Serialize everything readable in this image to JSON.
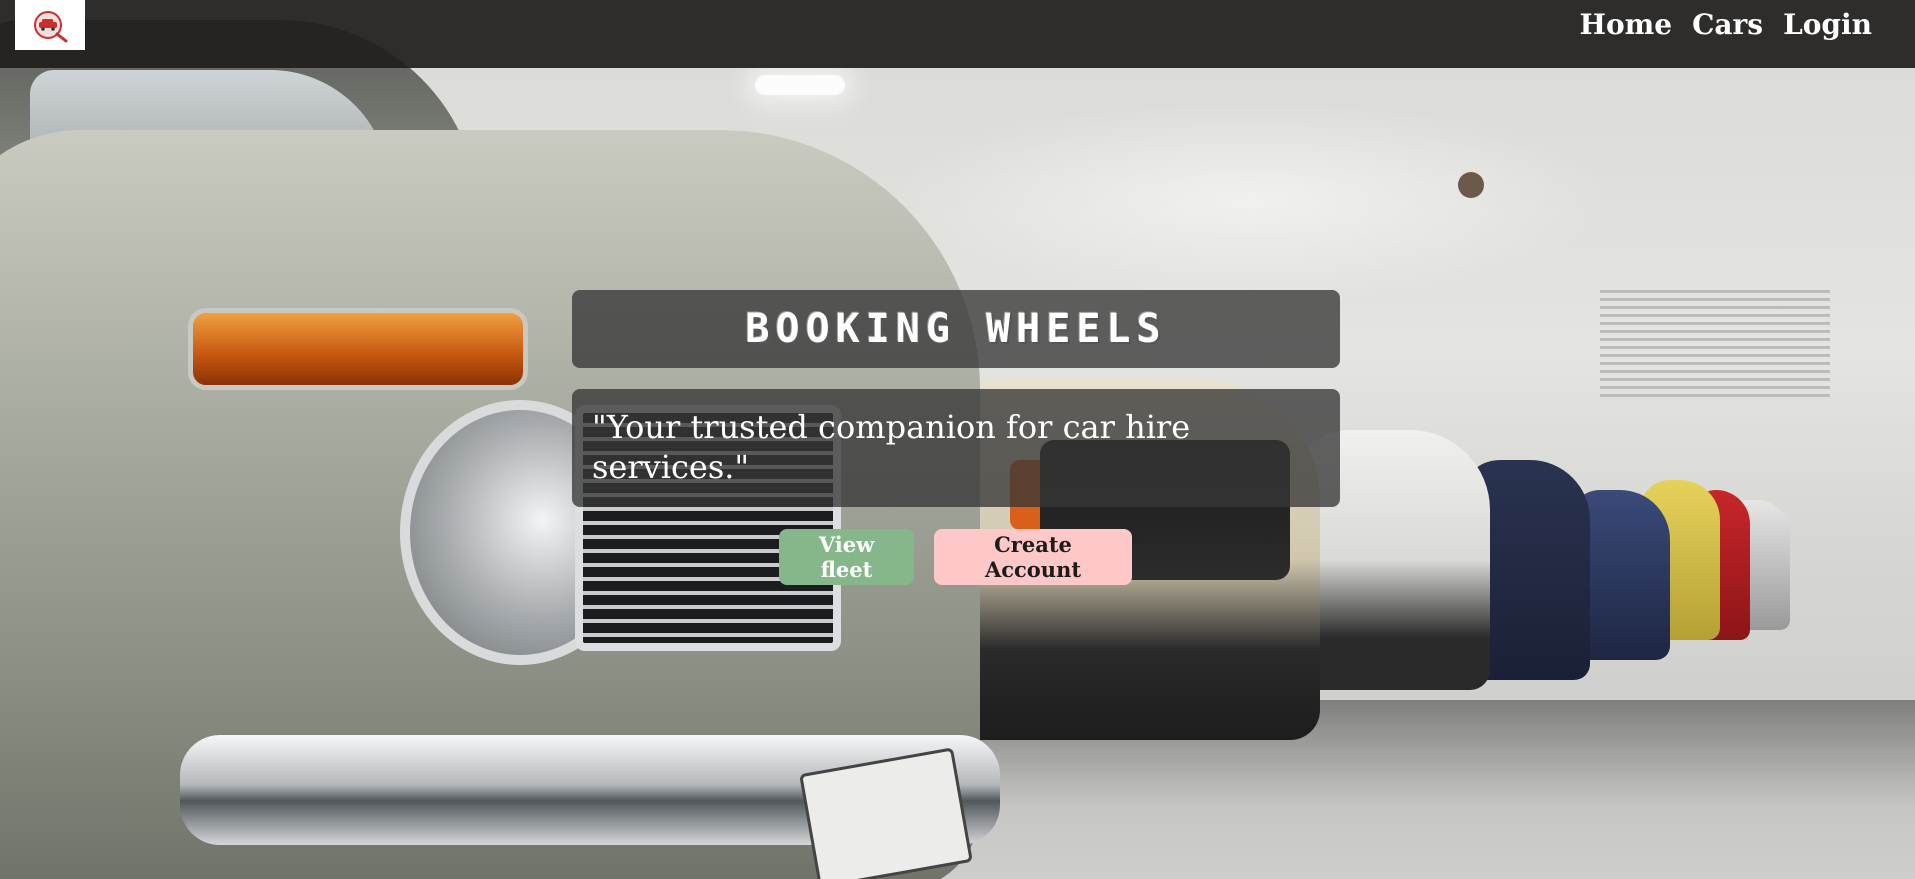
{
  "nav": {
    "logo_icon": "magnifier-car-logo-icon",
    "links": [
      {
        "label": "Home"
      },
      {
        "label": "Cars"
      },
      {
        "label": "Login"
      }
    ]
  },
  "hero": {
    "title": "Booking Wheels",
    "tagline": "\"Your trusted companion for car hire services.\"",
    "buttons": {
      "view_fleet": "View fleet",
      "create_account": "Create Account"
    }
  },
  "colors": {
    "navbar_bg": "#211f1e",
    "view_fleet_bg": "#85b78b",
    "create_account_bg": "#ffc8c8",
    "overlay_box": "#373737"
  }
}
